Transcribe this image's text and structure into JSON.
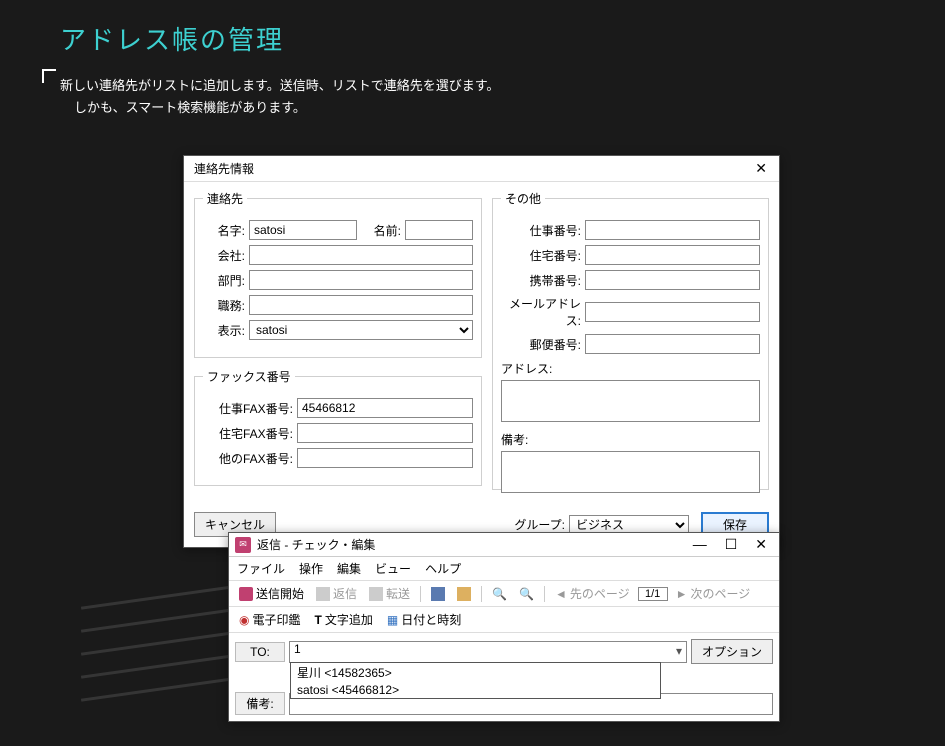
{
  "page": {
    "title": "アドレス帳の管理",
    "desc1": "新しい連絡先がリストに追加します。送信時、リストで連絡先を選びます。",
    "desc2": "しかも、スマート検索機能があります。"
  },
  "dialog": {
    "title": "連絡先情報",
    "groups": {
      "contact": "連絡先",
      "fax": "ファックス番号",
      "other": "その他"
    },
    "labels": {
      "lastname": "名字:",
      "firstname": "名前:",
      "company": "会社:",
      "department": "部門:",
      "job": "職務:",
      "display": "表示:",
      "workfax": "仕事FAX番号:",
      "homefax": "住宅FAX番号:",
      "otherfax": "他のFAX番号:",
      "workphone": "仕事番号:",
      "homephone": "住宅番号:",
      "mobile": "携帯番号:",
      "email": "メールアドレス:",
      "postal": "郵便番号:",
      "address": "アドレス:",
      "remarks": "備考:",
      "group": "グループ:"
    },
    "values": {
      "lastname": "satosi",
      "firstname": "",
      "company": "",
      "department": "",
      "job": "",
      "display": "satosi",
      "workfax": "45466812",
      "homefax": "",
      "otherfax": "",
      "workphone": "",
      "homephone": "",
      "mobile": "",
      "email": "",
      "postal": "",
      "address": "",
      "remarks": "",
      "group": "ビジネス"
    },
    "buttons": {
      "cancel": "キャンセル",
      "save": "保存"
    }
  },
  "win2": {
    "title": "返信 - チェック・編集",
    "menus": [
      "ファイル",
      "操作",
      "編集",
      "ビュー",
      "ヘルプ"
    ],
    "toolbar": {
      "send_start": "送信開始",
      "reply": "返信",
      "forward": "転送",
      "prev_page": "先のページ",
      "page": "1/1",
      "next_page": "次のページ"
    },
    "toolbar2": {
      "stamp": "電子印鑑",
      "text_add": "文字追加",
      "datetime": "日付と時刻"
    },
    "form": {
      "to_label": "TO:",
      "to_value": "1",
      "remarks_label": "備考:",
      "remarks_value": "",
      "option_btn": "オプション"
    },
    "dropdown": [
      "星川 <14582365>",
      "satosi <45466812>"
    ]
  }
}
